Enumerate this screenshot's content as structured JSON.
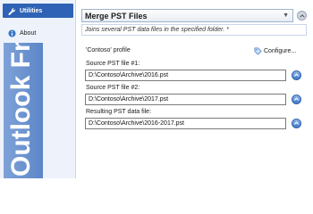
{
  "sidebar": {
    "items": [
      {
        "label": "Utilities",
        "icon": "wrench-icon"
      },
      {
        "label": "About",
        "icon": "info-icon"
      }
    ],
    "watermark": "Outlook Freeware.com"
  },
  "main": {
    "utility_select": "Merge PST Files",
    "description": "Joins several PST data files in the specified folder. *",
    "profile_label": "'Contoso' profile",
    "configure_label": "Configure...",
    "fields": [
      {
        "label": "Source PST file #1:",
        "value": "D:\\Contoso\\Archive\\2016.pst"
      },
      {
        "label": "Source PST file #2:",
        "value": "D:\\Contoso\\Archive\\2017.pst"
      },
      {
        "label": "Resulting PST data file:",
        "value": "D:\\Contoso\\Archive\\2016-2017.pst"
      }
    ]
  },
  "colors": {
    "accent": "#2f63b5",
    "sidebar_bg": "#eef3fb"
  }
}
